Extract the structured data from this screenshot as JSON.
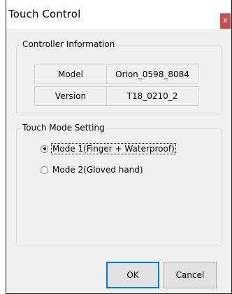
{
  "window": {
    "title": "Touch Control",
    "close_glyph": "x"
  },
  "controller_info": {
    "legend": "Controller Information",
    "rows": [
      {
        "label": "Model",
        "value": "Orion_0598_8084"
      },
      {
        "label": "Version",
        "value": "T18_0210_2"
      }
    ]
  },
  "touch_mode": {
    "legend": "Touch Mode Setting",
    "options": [
      {
        "label": "Mode 1(Finger + Waterproof)",
        "checked": true
      },
      {
        "label": "Mode 2(Gloved hand)",
        "checked": false
      }
    ]
  },
  "buttons": {
    "ok": "OK",
    "cancel": "Cancel"
  },
  "colors": {
    "close_button": "#c74f4f",
    "dialog_background": "#f0f0f0",
    "default_button_border": "#0078d7"
  }
}
